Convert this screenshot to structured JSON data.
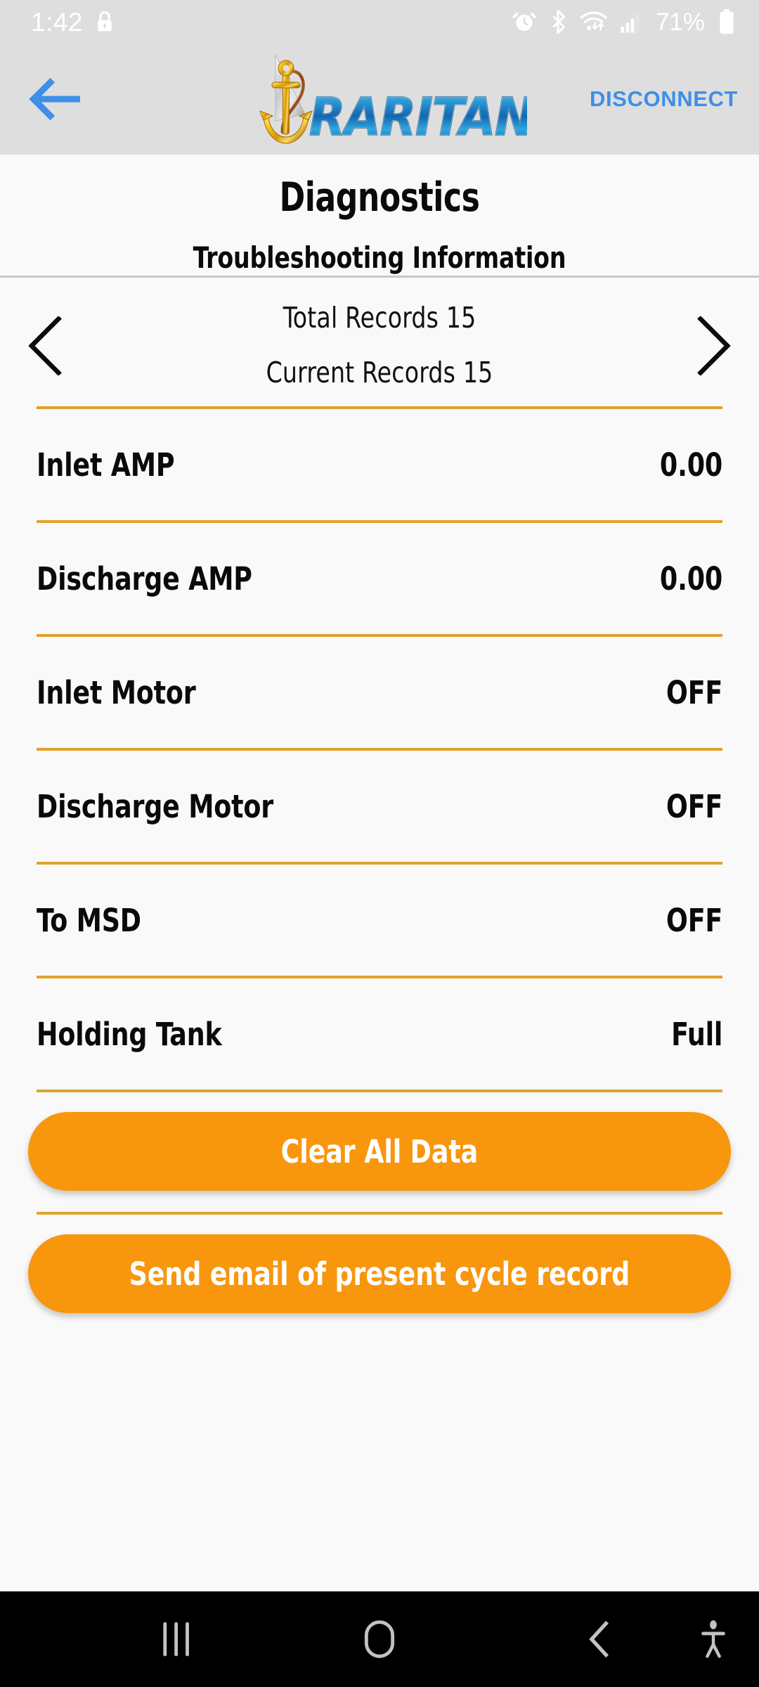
{
  "statusbar": {
    "time": "1:42",
    "lock_icon": "lock-icon",
    "icons": [
      "alarm-icon",
      "bluetooth-icon",
      "wifi-icon",
      "signal-icon"
    ],
    "battery_percent": "71%",
    "battery_icon": "battery-icon"
  },
  "header": {
    "back_icon": "back-arrow-icon",
    "logo_alt": "RARITAN",
    "disconnect_label": "DISCONNECT",
    "background_color": "#DEDEDE",
    "accent_blue": "#3D8FE8"
  },
  "titles": {
    "page_title": "Diagnostics",
    "subtitle": "Troubleshooting Information"
  },
  "records": {
    "prev_icon": "chevron-left-icon",
    "next_icon": "chevron-right-icon",
    "total_label": "Total Records 15",
    "current_label": "Current Records 15"
  },
  "rows": [
    {
      "label": "Inlet AMP",
      "value": "0.00"
    },
    {
      "label": "Discharge AMP",
      "value": "0.00"
    },
    {
      "label": "Inlet Motor",
      "value": "OFF"
    },
    {
      "label": "Discharge Motor",
      "value": "OFF"
    },
    {
      "label": "To MSD",
      "value": "OFF"
    },
    {
      "label": "Holding Tank",
      "value": "Full"
    }
  ],
  "buttons": {
    "clear_all": "Clear All Data",
    "send_email": "Send email of present cycle record",
    "color": "#F8960D"
  },
  "navbar": {
    "recent_icon": "recent-apps-icon",
    "home_icon": "home-icon",
    "back_icon": "nav-back-icon",
    "accessibility_icon": "accessibility-icon"
  },
  "colors": {
    "divider_gold": "#DFA22B",
    "page_bg": "#F9F9F9",
    "header_bg": "#DEDEDE"
  }
}
